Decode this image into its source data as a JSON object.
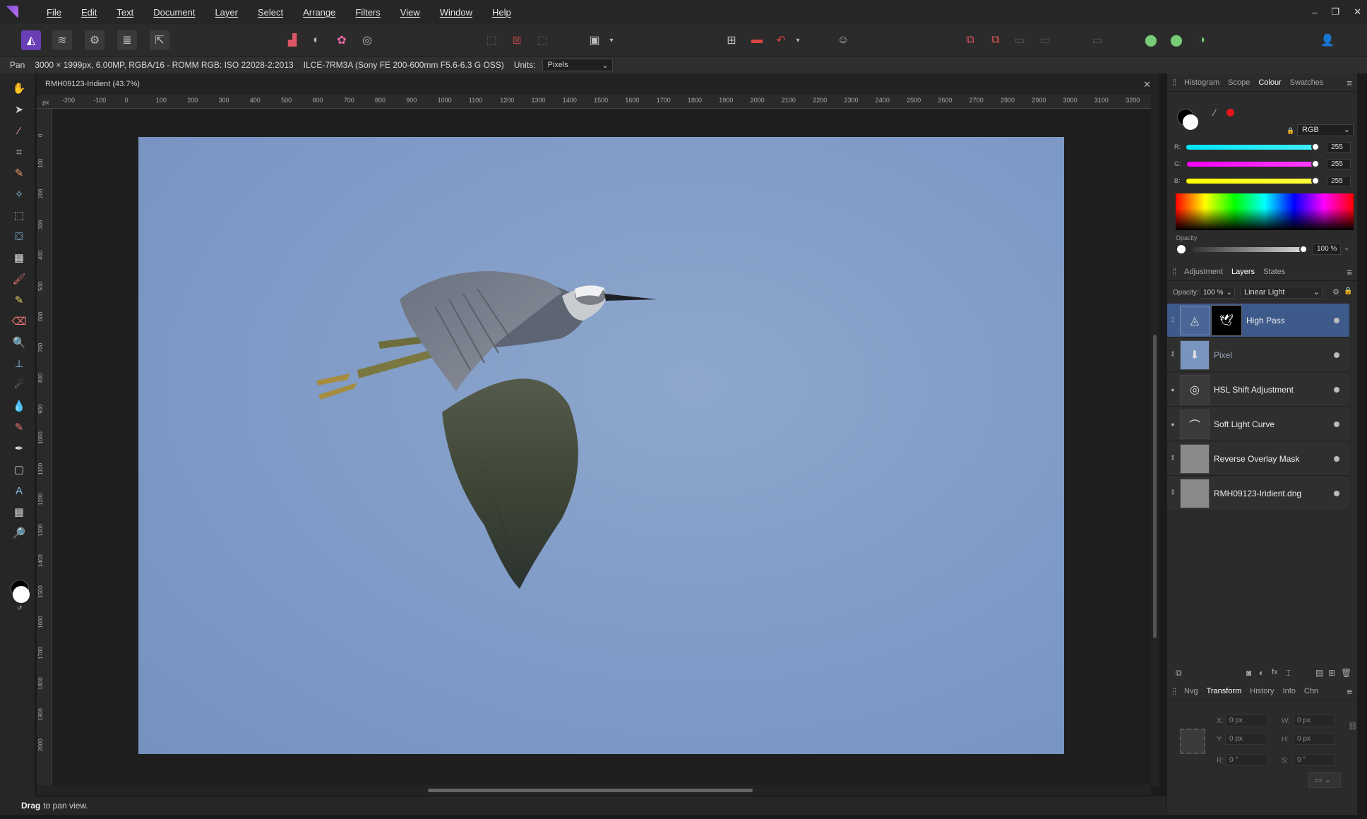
{
  "menubar": {
    "items": [
      "File",
      "Edit",
      "Text",
      "Document",
      "Layer",
      "Select",
      "Arrange",
      "Filters",
      "View",
      "Window",
      "Help"
    ],
    "window_controls": [
      "–",
      "❐",
      "✕"
    ]
  },
  "context": {
    "tool": "Pan",
    "doc_info": "3000 × 1999px, 6.00MP, RGBA/16 - ROMM RGB: ISO 22028-2:2013",
    "camera": "ILCE-7RM3A (Sony FE 200-600mm F5.6-6.3 G OSS)",
    "units_label": "Units:",
    "units_value": "Pixels"
  },
  "document": {
    "title": "RMH09123-Iridient (43.7%)",
    "close": "✕",
    "ruler_unit": "px",
    "ruler_h_ticks": [
      "-200",
      "-100",
      "0",
      "100",
      "200",
      "300",
      "400",
      "500",
      "600",
      "700",
      "800",
      "900",
      "1000",
      "1100",
      "1200",
      "1300",
      "1400",
      "1500",
      "1600",
      "1700",
      "1800",
      "1900",
      "2000",
      "2100",
      "2200",
      "2300",
      "2400",
      "2500",
      "2600",
      "2700",
      "2800",
      "2900",
      "3000",
      "3100",
      "3200"
    ],
    "ruler_v_ticks": [
      "0",
      "100",
      "200",
      "300",
      "400",
      "500",
      "600",
      "700",
      "800",
      "900",
      "1000",
      "1100",
      "1200",
      "1300",
      "1400",
      "1500",
      "1600",
      "1700",
      "1800",
      "1900",
      "2000"
    ]
  },
  "status": {
    "bold": "Drag",
    "text": "to pan view."
  },
  "colour_panel": {
    "tabs": [
      "Histogram",
      "Scope",
      "Colour",
      "Swatches"
    ],
    "active_tab": "Colour",
    "model": "RGB",
    "r_label": "R:",
    "r_value": "255",
    "g_label": "G:",
    "g_value": "255",
    "b_label": "B:",
    "b_value": "255",
    "opacity_label": "Opacity",
    "opacity_value": "100 %"
  },
  "layers_panel": {
    "tabs": [
      "Adjustment",
      "Layers",
      "States"
    ],
    "active_tab": "Layers",
    "opacity_label": "Opacity:",
    "opacity_value": "100 %",
    "blend_mode": "Linear Light",
    "layers": [
      {
        "name": "High Pass",
        "icon": "high-pass-icon"
      },
      {
        "name": "Pixel",
        "icon": "pixel-thumb"
      },
      {
        "name": "HSL Shift Adjustment",
        "icon": "hsl-icon"
      },
      {
        "name": "Soft Light Curve",
        "icon": "curves-icon"
      },
      {
        "name": "Reverse Overlay Mask",
        "icon": "mask-thumb"
      },
      {
        "name": "RMH09123-Iridient.dng",
        "icon": "image-thumb"
      }
    ]
  },
  "transform_panel": {
    "tabs": [
      "Nvg",
      "Transform",
      "History",
      "Info",
      "Chn"
    ],
    "active_tab": "Transform",
    "x_label": "X:",
    "x_value": "0 px",
    "y_label": "Y:",
    "y_value": "0 px",
    "w_label": "W:",
    "w_value": "0 px",
    "h_label": "H:",
    "h_value": "0 px",
    "r_label": "R:",
    "r_value": "0 °",
    "s_label": "S:",
    "s_value": "0 °"
  },
  "colors": {
    "accent": "#6a3fb5",
    "selected_layer": "#3d5a8a",
    "sky": "#7e9ac6"
  }
}
